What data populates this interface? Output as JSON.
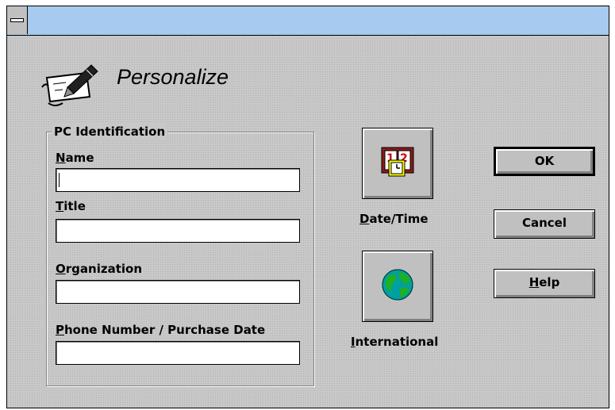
{
  "window": {
    "title": ""
  },
  "header": {
    "title": "Personalize",
    "icon": "pen-and-paper-icon"
  },
  "group": {
    "label": "PC Identification",
    "fields": [
      {
        "label_key": "N",
        "label_rest": "ame",
        "value": ""
      },
      {
        "label_key": "T",
        "label_rest": "itle",
        "value": ""
      },
      {
        "label_key": "O",
        "label_rest": "rganization",
        "value": ""
      },
      {
        "label_key": "P",
        "label_rest": "hone Number / Purchase Date",
        "value": ""
      }
    ]
  },
  "launchers": {
    "datetime": {
      "label_key": "D",
      "label_rest": "ate/Time",
      "icon": "calendar-clock-icon"
    },
    "international": {
      "label_key": "I",
      "label_rest": "nternational",
      "icon": "globe-icon"
    }
  },
  "buttons": {
    "ok": "OK",
    "cancel": "Cancel",
    "help_key": "H",
    "help_rest": "elp"
  },
  "colors": {
    "titlebar": "#a6caf0",
    "dialog_bg": "#c8c8c8",
    "button_face": "#c0c0c0"
  }
}
